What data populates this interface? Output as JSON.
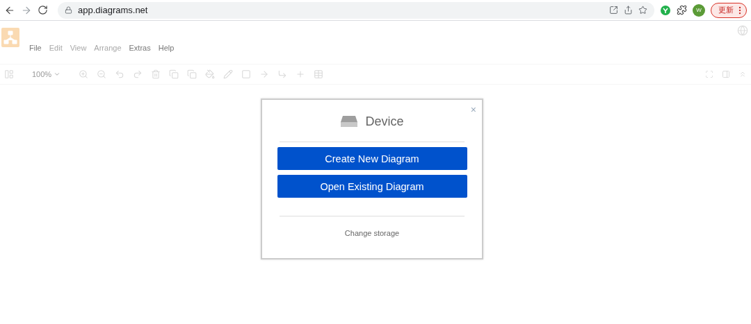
{
  "browser": {
    "address": "app.diagrams.net",
    "avatar": "W",
    "update_label": "更新"
  },
  "menu": [
    {
      "label": "File",
      "disabled": false
    },
    {
      "label": "Edit",
      "disabled": true
    },
    {
      "label": "View",
      "disabled": true
    },
    {
      "label": "Arrange",
      "disabled": true
    },
    {
      "label": "Extras",
      "disabled": false
    },
    {
      "label": "Help",
      "disabled": false
    }
  ],
  "toolbar": {
    "zoom": "100%"
  },
  "dialog": {
    "title": "Device",
    "close": "×",
    "buttons": [
      "Create New Diagram",
      "Open Existing Diagram"
    ],
    "link": "Change storage"
  }
}
